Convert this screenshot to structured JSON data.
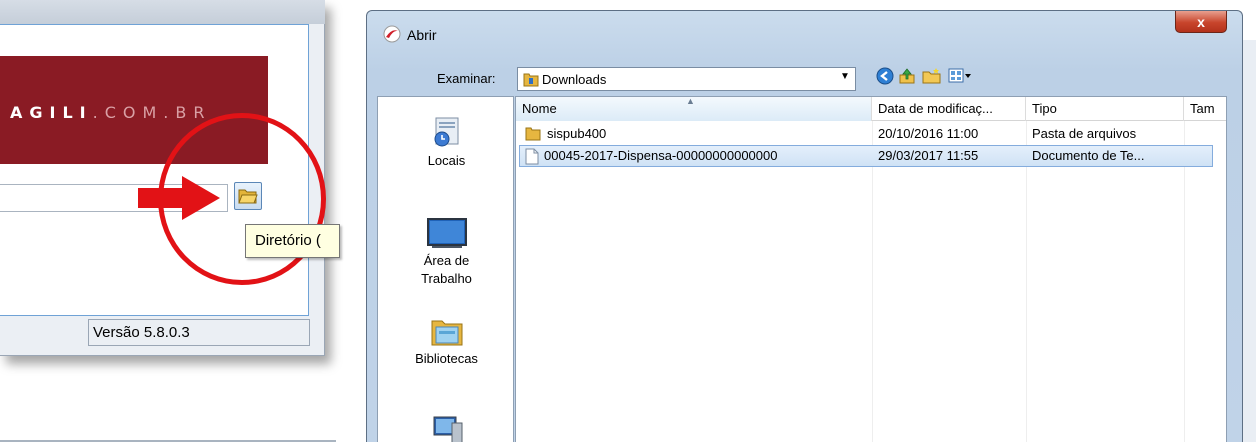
{
  "left_app": {
    "banner_text_bold": "AGILI",
    "banner_text_light": ".COM.BR",
    "tooltip": "Diretório (",
    "version": "Versão 5.8.0.3",
    "accent_red": "#e21216",
    "banner_color": "#8a1b24"
  },
  "dialog": {
    "title": "Abrir",
    "close_label": "x",
    "look_in_label": "Examinar:",
    "look_in_value": "Downloads",
    "toolbar_icons": [
      "back-icon",
      "up-folder-icon",
      "new-folder-icon",
      "view-menu-icon"
    ],
    "places": [
      {
        "label": "Locais",
        "icon": "recent-places-icon"
      },
      {
        "label": "Área de Trabalho",
        "icon": "desktop-icon"
      },
      {
        "label": "Bibliotecas",
        "icon": "libraries-icon"
      },
      {
        "label": "",
        "icon": "computer-icon"
      }
    ],
    "columns": [
      "Nome",
      "Data de modificaç...",
      "Tipo",
      "Tam"
    ],
    "files": [
      {
        "name": "sispub400",
        "date": "20/10/2016 11:00",
        "type": "Pasta de arquivos",
        "icon": "folder-icon",
        "selected": false
      },
      {
        "name": "00045-2017-Dispensa-00000000000000",
        "date": "29/03/2017 11:55",
        "type": "Documento de Te...",
        "icon": "text-document-icon",
        "selected": true
      }
    ]
  }
}
